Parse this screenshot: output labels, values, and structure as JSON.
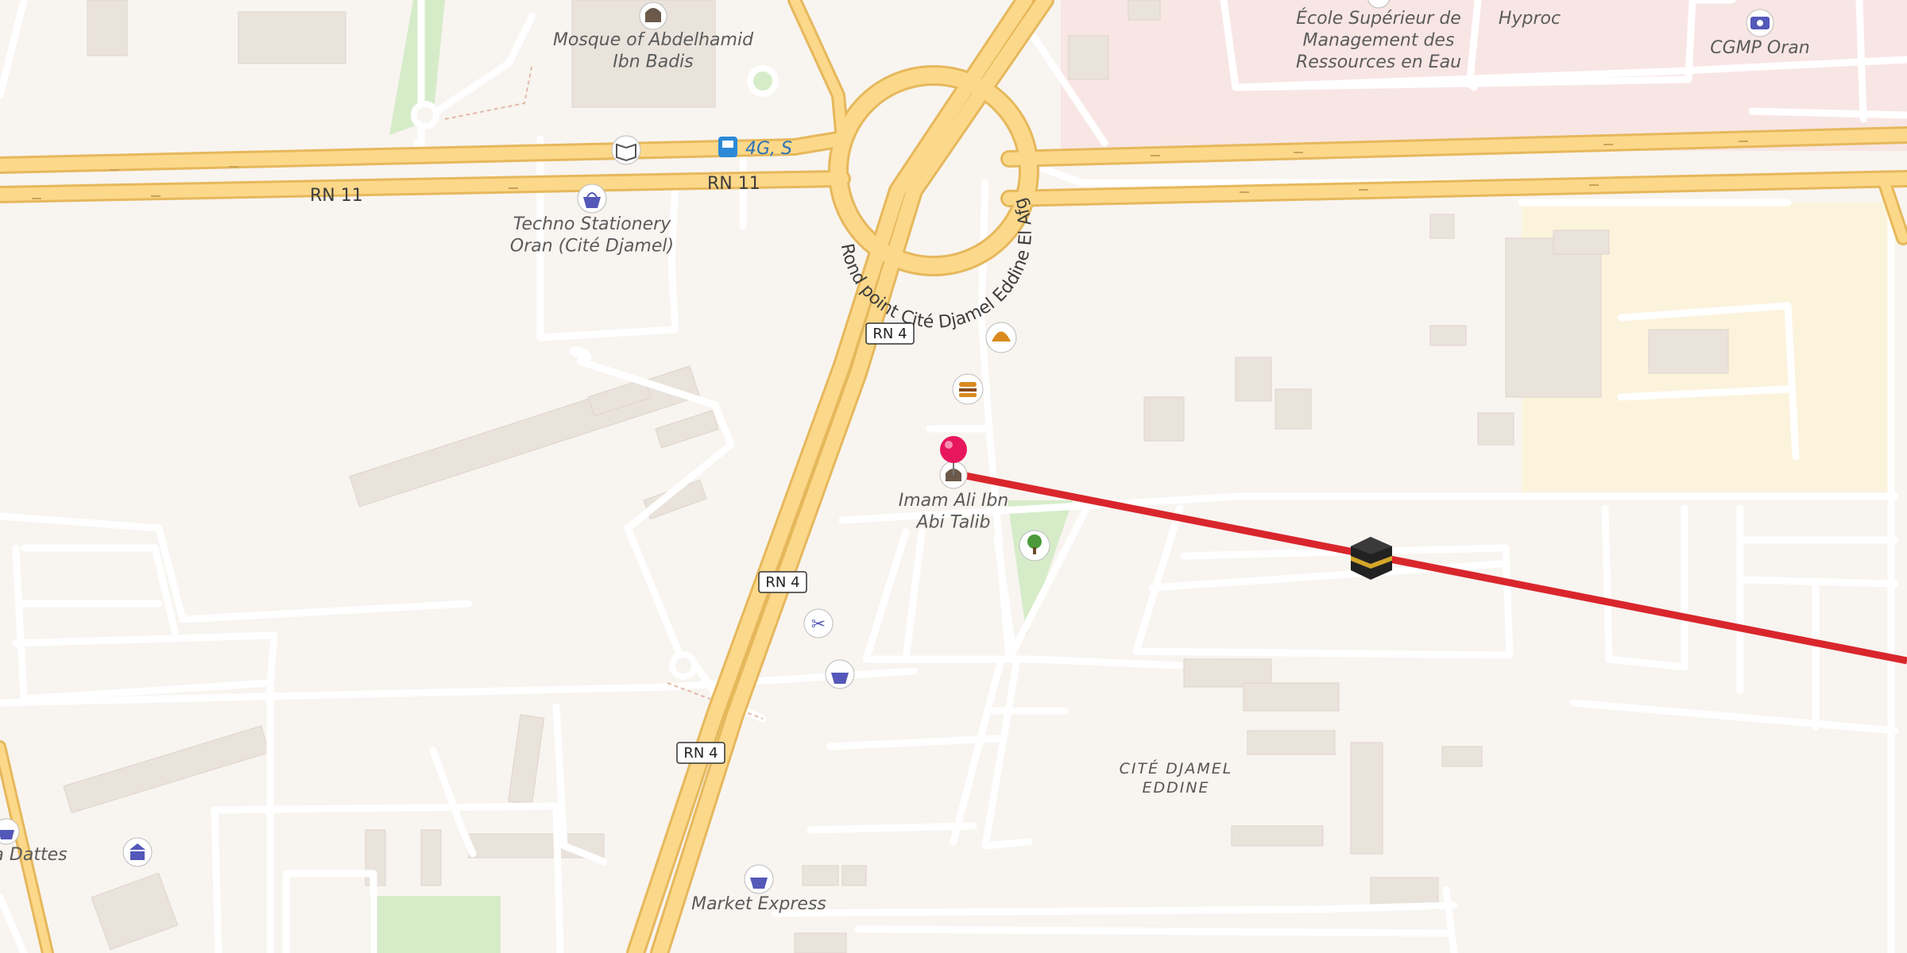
{
  "map": {
    "places": {
      "mosque_abdelhamid": "Mosque of Abdelhamid\nIbn Badis",
      "ecole": "École Supérieur de\nManagement des\nRessources en Eau",
      "hyproc": "Hyproc",
      "cgmp": "CGMP Oran",
      "techno": "Techno Stationery\nOran (Cité Djamel)",
      "imam_ali": "Imam Ali Ibn\nAbi Talib",
      "market_express": "Market Express",
      "dattes": "a Dattes",
      "district": "CITÉ DJAMEL\nEDDINE"
    },
    "roads": {
      "rn11_a": "RN 11",
      "rn11_b": "RN 11",
      "roundabout": "Rond point Cité Djamel Eddine El Afghani",
      "bus_stop": "4G, S"
    },
    "shields": [
      "RN 4",
      "RN 4",
      "RN 4"
    ],
    "colors": {
      "background": "#f8f4f0",
      "road_major": "#fcd88a",
      "road_casing": "#e6b85c",
      "route_line": "#d9262c",
      "pin": "#e8175d",
      "poi_shop": "#5458b8",
      "poi_food": "#d98a1e",
      "poi_park": "#4b9a3a",
      "school_area": "#f8e6e4",
      "yellow_area": "#fbf3dc",
      "green_area": "#d6ecc9"
    },
    "icons": [
      "mosque-icon",
      "shopping-basket-icon",
      "bus-stop-icon",
      "book-icon",
      "bakery-icon",
      "burger-icon",
      "scissors-icon",
      "tree-icon",
      "money-icon",
      "kaaba-icon",
      "pin-icon",
      "museum-icon"
    ]
  }
}
